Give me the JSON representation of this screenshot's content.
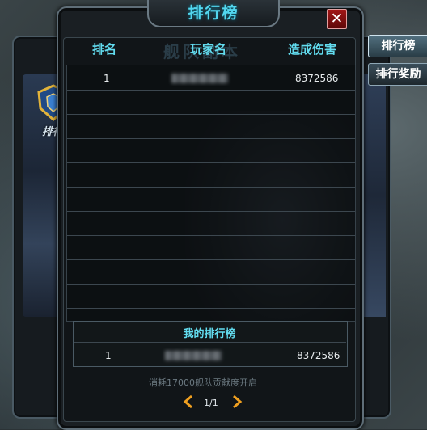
{
  "title": "排行榜",
  "close_icon": "close-x-icon",
  "watermark": "舰队副本",
  "emblem_label": "排行榜",
  "columns": {
    "rank": "排名",
    "player": "玩家名",
    "damage": "造成伤害"
  },
  "rows": [
    {
      "rank": "1",
      "damage": "8372586"
    }
  ],
  "my_rank": {
    "title": "我的排行榜",
    "rank": "1",
    "damage": "8372586"
  },
  "note": "消耗17000舰队贡献度开启",
  "pager": {
    "text": "1/1"
  },
  "side_tabs": {
    "leaderboard": "排行榜",
    "rewards": "排行奖励"
  },
  "colors": {
    "accent": "#62dcef",
    "close": "#a21717",
    "pager_arrow": "#f0a020"
  }
}
